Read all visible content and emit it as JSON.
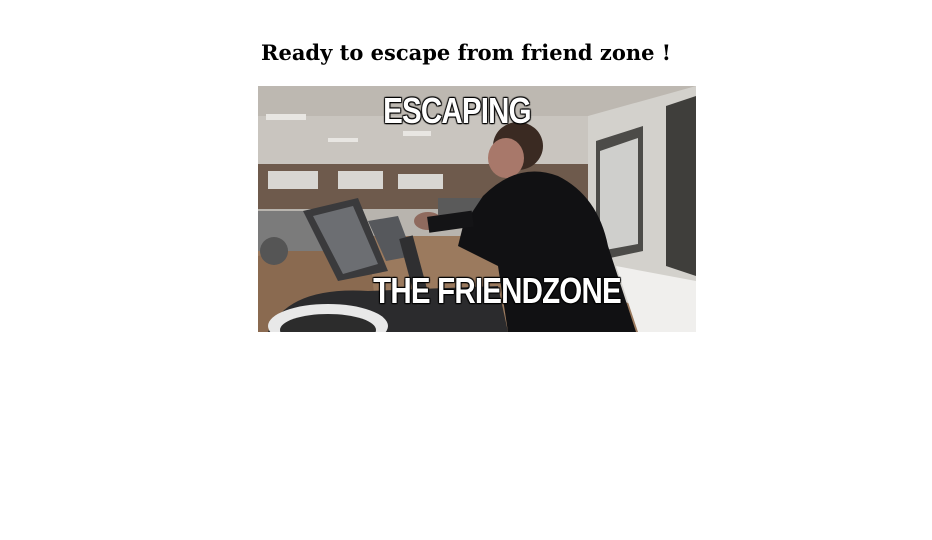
{
  "page": {
    "title": "Ready to escape from friend zone !"
  },
  "meme": {
    "top_text": "ESCAPING",
    "bottom_text": "THE FRIENDZONE"
  }
}
